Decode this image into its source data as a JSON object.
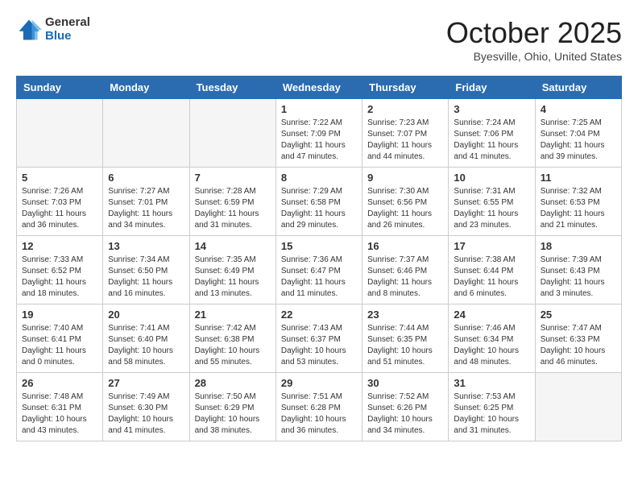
{
  "header": {
    "logo_general": "General",
    "logo_blue": "Blue",
    "month_title": "October 2025",
    "location": "Byesville, Ohio, United States"
  },
  "weekdays": [
    "Sunday",
    "Monday",
    "Tuesday",
    "Wednesday",
    "Thursday",
    "Friday",
    "Saturday"
  ],
  "weeks": [
    [
      {
        "day": "",
        "empty": true
      },
      {
        "day": "",
        "empty": true
      },
      {
        "day": "",
        "empty": true
      },
      {
        "day": "1",
        "sunrise": "Sunrise: 7:22 AM",
        "sunset": "Sunset: 7:09 PM",
        "daylight": "Daylight: 11 hours and 47 minutes."
      },
      {
        "day": "2",
        "sunrise": "Sunrise: 7:23 AM",
        "sunset": "Sunset: 7:07 PM",
        "daylight": "Daylight: 11 hours and 44 minutes."
      },
      {
        "day": "3",
        "sunrise": "Sunrise: 7:24 AM",
        "sunset": "Sunset: 7:06 PM",
        "daylight": "Daylight: 11 hours and 41 minutes."
      },
      {
        "day": "4",
        "sunrise": "Sunrise: 7:25 AM",
        "sunset": "Sunset: 7:04 PM",
        "daylight": "Daylight: 11 hours and 39 minutes."
      }
    ],
    [
      {
        "day": "5",
        "sunrise": "Sunrise: 7:26 AM",
        "sunset": "Sunset: 7:03 PM",
        "daylight": "Daylight: 11 hours and 36 minutes."
      },
      {
        "day": "6",
        "sunrise": "Sunrise: 7:27 AM",
        "sunset": "Sunset: 7:01 PM",
        "daylight": "Daylight: 11 hours and 34 minutes."
      },
      {
        "day": "7",
        "sunrise": "Sunrise: 7:28 AM",
        "sunset": "Sunset: 6:59 PM",
        "daylight": "Daylight: 11 hours and 31 minutes."
      },
      {
        "day": "8",
        "sunrise": "Sunrise: 7:29 AM",
        "sunset": "Sunset: 6:58 PM",
        "daylight": "Daylight: 11 hours and 29 minutes."
      },
      {
        "day": "9",
        "sunrise": "Sunrise: 7:30 AM",
        "sunset": "Sunset: 6:56 PM",
        "daylight": "Daylight: 11 hours and 26 minutes."
      },
      {
        "day": "10",
        "sunrise": "Sunrise: 7:31 AM",
        "sunset": "Sunset: 6:55 PM",
        "daylight": "Daylight: 11 hours and 23 minutes."
      },
      {
        "day": "11",
        "sunrise": "Sunrise: 7:32 AM",
        "sunset": "Sunset: 6:53 PM",
        "daylight": "Daylight: 11 hours and 21 minutes."
      }
    ],
    [
      {
        "day": "12",
        "sunrise": "Sunrise: 7:33 AM",
        "sunset": "Sunset: 6:52 PM",
        "daylight": "Daylight: 11 hours and 18 minutes."
      },
      {
        "day": "13",
        "sunrise": "Sunrise: 7:34 AM",
        "sunset": "Sunset: 6:50 PM",
        "daylight": "Daylight: 11 hours and 16 minutes."
      },
      {
        "day": "14",
        "sunrise": "Sunrise: 7:35 AM",
        "sunset": "Sunset: 6:49 PM",
        "daylight": "Daylight: 11 hours and 13 minutes."
      },
      {
        "day": "15",
        "sunrise": "Sunrise: 7:36 AM",
        "sunset": "Sunset: 6:47 PM",
        "daylight": "Daylight: 11 hours and 11 minutes."
      },
      {
        "day": "16",
        "sunrise": "Sunrise: 7:37 AM",
        "sunset": "Sunset: 6:46 PM",
        "daylight": "Daylight: 11 hours and 8 minutes."
      },
      {
        "day": "17",
        "sunrise": "Sunrise: 7:38 AM",
        "sunset": "Sunset: 6:44 PM",
        "daylight": "Daylight: 11 hours and 6 minutes."
      },
      {
        "day": "18",
        "sunrise": "Sunrise: 7:39 AM",
        "sunset": "Sunset: 6:43 PM",
        "daylight": "Daylight: 11 hours and 3 minutes."
      }
    ],
    [
      {
        "day": "19",
        "sunrise": "Sunrise: 7:40 AM",
        "sunset": "Sunset: 6:41 PM",
        "daylight": "Daylight: 11 hours and 0 minutes."
      },
      {
        "day": "20",
        "sunrise": "Sunrise: 7:41 AM",
        "sunset": "Sunset: 6:40 PM",
        "daylight": "Daylight: 10 hours and 58 minutes."
      },
      {
        "day": "21",
        "sunrise": "Sunrise: 7:42 AM",
        "sunset": "Sunset: 6:38 PM",
        "daylight": "Daylight: 10 hours and 55 minutes."
      },
      {
        "day": "22",
        "sunrise": "Sunrise: 7:43 AM",
        "sunset": "Sunset: 6:37 PM",
        "daylight": "Daylight: 10 hours and 53 minutes."
      },
      {
        "day": "23",
        "sunrise": "Sunrise: 7:44 AM",
        "sunset": "Sunset: 6:35 PM",
        "daylight": "Daylight: 10 hours and 51 minutes."
      },
      {
        "day": "24",
        "sunrise": "Sunrise: 7:46 AM",
        "sunset": "Sunset: 6:34 PM",
        "daylight": "Daylight: 10 hours and 48 minutes."
      },
      {
        "day": "25",
        "sunrise": "Sunrise: 7:47 AM",
        "sunset": "Sunset: 6:33 PM",
        "daylight": "Daylight: 10 hours and 46 minutes."
      }
    ],
    [
      {
        "day": "26",
        "sunrise": "Sunrise: 7:48 AM",
        "sunset": "Sunset: 6:31 PM",
        "daylight": "Daylight: 10 hours and 43 minutes."
      },
      {
        "day": "27",
        "sunrise": "Sunrise: 7:49 AM",
        "sunset": "Sunset: 6:30 PM",
        "daylight": "Daylight: 10 hours and 41 minutes."
      },
      {
        "day": "28",
        "sunrise": "Sunrise: 7:50 AM",
        "sunset": "Sunset: 6:29 PM",
        "daylight": "Daylight: 10 hours and 38 minutes."
      },
      {
        "day": "29",
        "sunrise": "Sunrise: 7:51 AM",
        "sunset": "Sunset: 6:28 PM",
        "daylight": "Daylight: 10 hours and 36 minutes."
      },
      {
        "day": "30",
        "sunrise": "Sunrise: 7:52 AM",
        "sunset": "Sunset: 6:26 PM",
        "daylight": "Daylight: 10 hours and 34 minutes."
      },
      {
        "day": "31",
        "sunrise": "Sunrise: 7:53 AM",
        "sunset": "Sunset: 6:25 PM",
        "daylight": "Daylight: 10 hours and 31 minutes."
      },
      {
        "day": "",
        "empty": true
      }
    ]
  ]
}
